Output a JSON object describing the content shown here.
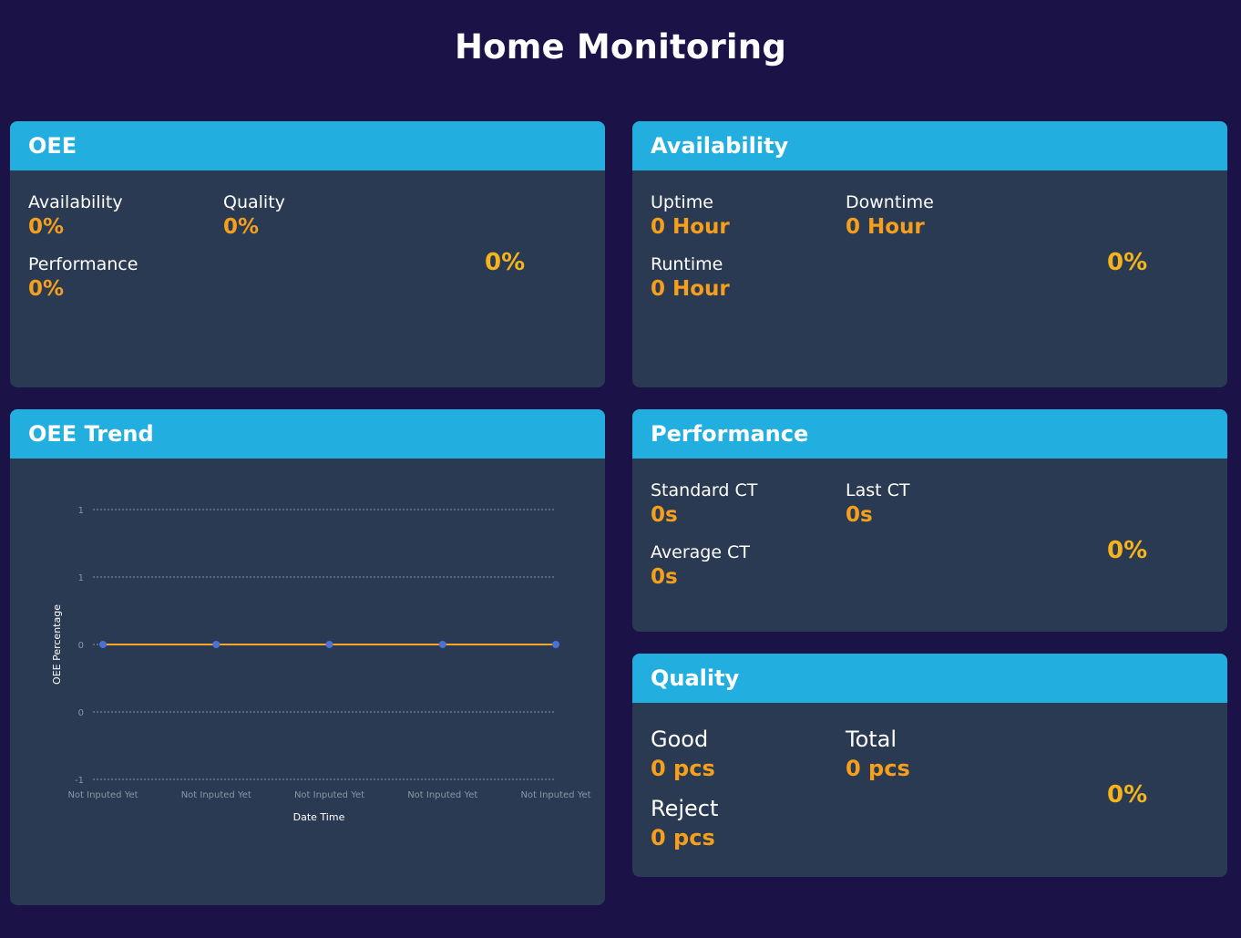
{
  "page": {
    "title": "Home Monitoring"
  },
  "colors": {
    "background": "#1b1248",
    "card": "#293a52",
    "header": "#22afe0",
    "value": "#f59f1c",
    "percent": "#f5b41c",
    "line": "#f5a623",
    "point": "#4a72d6"
  },
  "oee": {
    "title": "OEE",
    "availability_label": "Availability",
    "availability_value": "0%",
    "quality_label": "Quality",
    "quality_value": "0%",
    "performance_label": "Performance",
    "performance_value": "0%",
    "overall": "0%"
  },
  "availability": {
    "title": "Availability",
    "uptime_label": "Uptime",
    "uptime_value": "0 Hour",
    "downtime_label": "Downtime",
    "downtime_value": "0 Hour",
    "runtime_label": "Runtime",
    "runtime_value": "0 Hour",
    "overall": "0%"
  },
  "trend": {
    "title": "OEE Trend"
  },
  "performance": {
    "title": "Performance",
    "standard_ct_label": "Standard CT",
    "standard_ct_value": "0s",
    "last_ct_label": "Last CT",
    "last_ct_value": "0s",
    "average_ct_label": "Average CT",
    "average_ct_value": "0s",
    "overall": "0%"
  },
  "quality": {
    "title": "Quality",
    "good_label": "Good",
    "good_value": "0 pcs",
    "total_label": "Total",
    "total_value": "0 pcs",
    "reject_label": "Reject",
    "reject_value": "0 pcs",
    "overall": "0%"
  },
  "chart_data": {
    "type": "line",
    "title": "",
    "xlabel": "Date Time",
    "ylabel": "OEE Percentage",
    "categories": [
      "Not Inputed Yet",
      "Not Inputed Yet",
      "Not Inputed Yet",
      "Not Inputed Yet",
      "Not Inputed Yet"
    ],
    "series": [
      {
        "values": [
          0,
          0,
          0,
          0,
          0
        ]
      }
    ],
    "ylim": [
      -1,
      1
    ],
    "y_tick_labels": [
      "1",
      "1",
      "0",
      "0",
      "-1"
    ],
    "grid": true,
    "legend": "none"
  }
}
